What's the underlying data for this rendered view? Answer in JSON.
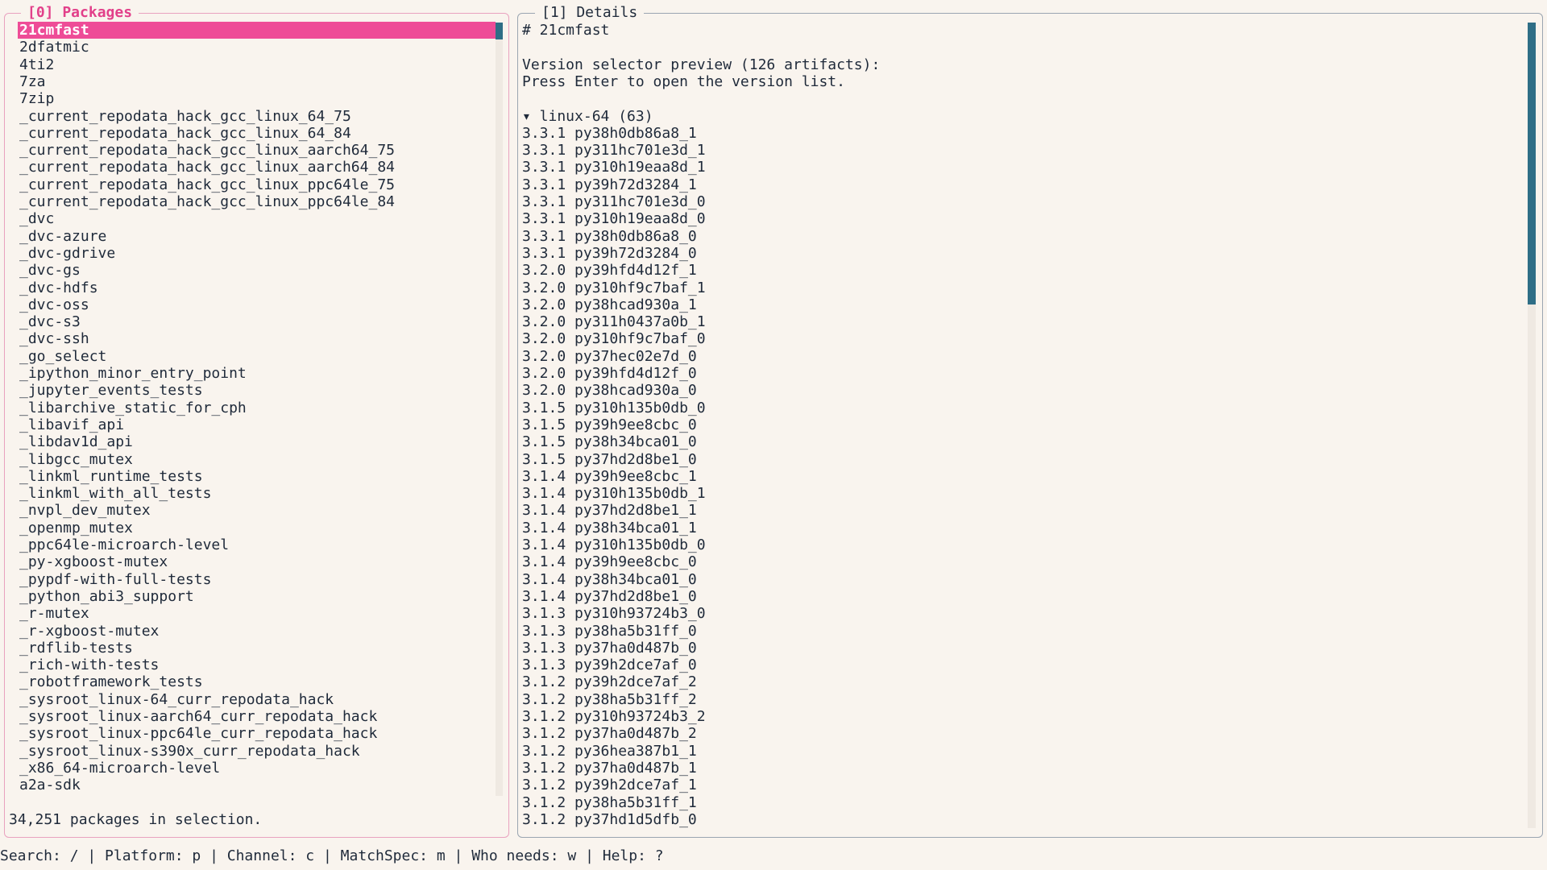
{
  "packages_panel": {
    "title": "[0] Packages",
    "items": [
      "21cmfast",
      "2dfatmic",
      "4ti2",
      "7za",
      "7zip",
      "_current_repodata_hack_gcc_linux_64_75",
      "_current_repodata_hack_gcc_linux_64_84",
      "_current_repodata_hack_gcc_linux_aarch64_75",
      "_current_repodata_hack_gcc_linux_aarch64_84",
      "_current_repodata_hack_gcc_linux_ppc64le_75",
      "_current_repodata_hack_gcc_linux_ppc64le_84",
      "_dvc",
      "_dvc-azure",
      "_dvc-gdrive",
      "_dvc-gs",
      "_dvc-hdfs",
      "_dvc-oss",
      "_dvc-s3",
      "_dvc-ssh",
      "_go_select",
      "_ipython_minor_entry_point",
      "_jupyter_events_tests",
      "_libarchive_static_for_cph",
      "_libavif_api",
      "_libdav1d_api",
      "_libgcc_mutex",
      "_linkml_runtime_tests",
      "_linkml_with_all_tests",
      "_nvpl_dev_mutex",
      "_openmp_mutex",
      "_ppc64le-microarch-level",
      "_py-xgboost-mutex",
      "_pypdf-with-full-tests",
      "_python_abi3_support",
      "_r-mutex",
      "_r-xgboost-mutex",
      "_rdflib-tests",
      "_rich-with-tests",
      "_robotframework_tests",
      "_sysroot_linux-64_curr_repodata_hack",
      "_sysroot_linux-aarch64_curr_repodata_hack",
      "_sysroot_linux-ppc64le_curr_repodata_hack",
      "_sysroot_linux-s390x_curr_repodata_hack",
      "_x86_64-microarch-level",
      "a2a-sdk"
    ],
    "selected_index": 0,
    "status": "34,251 packages in selection."
  },
  "details_panel": {
    "title": "[1] Details",
    "heading": "# 21cmfast",
    "preview_line1": "Version selector preview (126 artifacts):",
    "preview_line2": "Press Enter to open the version list.",
    "group_label": "▾ linux-64 (63)",
    "versions": [
      "3.3.1 py38h0db86a8_1",
      "3.3.1 py311hc701e3d_1",
      "3.3.1 py310h19eaa8d_1",
      "3.3.1 py39h72d3284_1",
      "3.3.1 py311hc701e3d_0",
      "3.3.1 py310h19eaa8d_0",
      "3.3.1 py38h0db86a8_0",
      "3.3.1 py39h72d3284_0",
      "3.2.0 py39hfd4d12f_1",
      "3.2.0 py310hf9c7baf_1",
      "3.2.0 py38hcad930a_1",
      "3.2.0 py311h0437a0b_1",
      "3.2.0 py310hf9c7baf_0",
      "3.2.0 py37hec02e7d_0",
      "3.2.0 py39hfd4d12f_0",
      "3.2.0 py38hcad930a_0",
      "3.1.5 py310h135b0db_0",
      "3.1.5 py39h9ee8cbc_0",
      "3.1.5 py38h34bca01_0",
      "3.1.5 py37hd2d8be1_0",
      "3.1.4 py39h9ee8cbc_1",
      "3.1.4 py310h135b0db_1",
      "3.1.4 py37hd2d8be1_1",
      "3.1.4 py38h34bca01_1",
      "3.1.4 py310h135b0db_0",
      "3.1.4 py39h9ee8cbc_0",
      "3.1.4 py38h34bca01_0",
      "3.1.4 py37hd2d8be1_0",
      "3.1.3 py310h93724b3_0",
      "3.1.3 py38ha5b31ff_0",
      "3.1.3 py37ha0d487b_0",
      "3.1.3 py39h2dce7af_0",
      "3.1.2 py39h2dce7af_2",
      "3.1.2 py38ha5b31ff_2",
      "3.1.2 py310h93724b3_2",
      "3.1.2 py37ha0d487b_2",
      "3.1.2 py36hea387b1_1",
      "3.1.2 py37ha0d487b_1",
      "3.1.2 py39h2dce7af_1",
      "3.1.2 py38ha5b31ff_1",
      "3.1.2 py37hd1d5dfb_0"
    ]
  },
  "footer": {
    "keybindings": "Search: / | Platform: p | Channel: c | MatchSpec: m | Who needs: w | Help: ?"
  },
  "colors": {
    "accent": "#ee4c97",
    "scrollbar": "#2f6e86",
    "background": "#f9f4ee"
  }
}
